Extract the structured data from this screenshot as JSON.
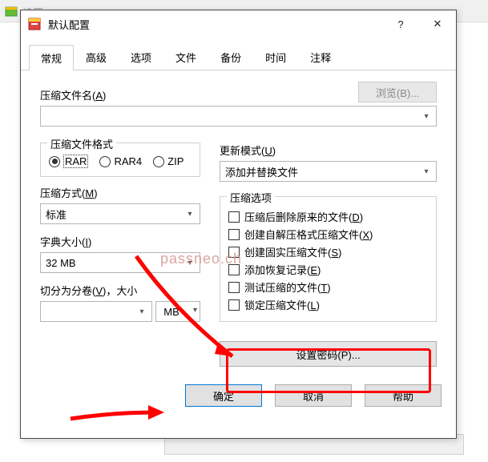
{
  "bg_window": {
    "title": "设置"
  },
  "dialog": {
    "title": "默认配置",
    "help_glyph": "?",
    "close_glyph": "✕"
  },
  "tabs": [
    "常规",
    "高级",
    "选项",
    "文件",
    "备份",
    "时间",
    "注释"
  ],
  "archive": {
    "label": "压缩文件名(",
    "label_u": "A",
    "label_end": ")",
    "browse": "浏览(B)...",
    "value": ""
  },
  "update": {
    "label": "更新模式(",
    "label_u": "U",
    "label_end": ")",
    "value": "添加并替换文件"
  },
  "format": {
    "legend": "压缩文件格式",
    "options": [
      "RAR",
      "RAR4",
      "ZIP"
    ],
    "selected": "RAR"
  },
  "method": {
    "label": "压缩方式(",
    "label_u": "M",
    "label_end": ")",
    "value": "标准"
  },
  "dict": {
    "label": "字典大小(",
    "label_u": "I",
    "label_end": ")",
    "value": "32 MB"
  },
  "split": {
    "label": "切分为分卷(",
    "label_u": "V",
    "label_end": ")，大小",
    "value": "",
    "unit": "MB"
  },
  "options": {
    "legend": "压缩选项",
    "items": [
      {
        "text": "压缩后删除原来的文件(",
        "u": "D",
        "end": ")"
      },
      {
        "text": "创建自解压格式压缩文件(",
        "u": "X",
        "end": ")"
      },
      {
        "text": "创建固实压缩文件(",
        "u": "S",
        "end": ")"
      },
      {
        "text": "添加恢复记录(",
        "u": "E",
        "end": ")"
      },
      {
        "text": "测试压缩的文件(",
        "u": "T",
        "end": ")"
      },
      {
        "text": "锁定压缩文件(",
        "u": "L",
        "end": ")"
      }
    ]
  },
  "password_btn": "设置密码(P)...",
  "footer": {
    "ok": "确定",
    "cancel": "取消",
    "help": "帮助"
  },
  "watermark": "passneo.ch"
}
